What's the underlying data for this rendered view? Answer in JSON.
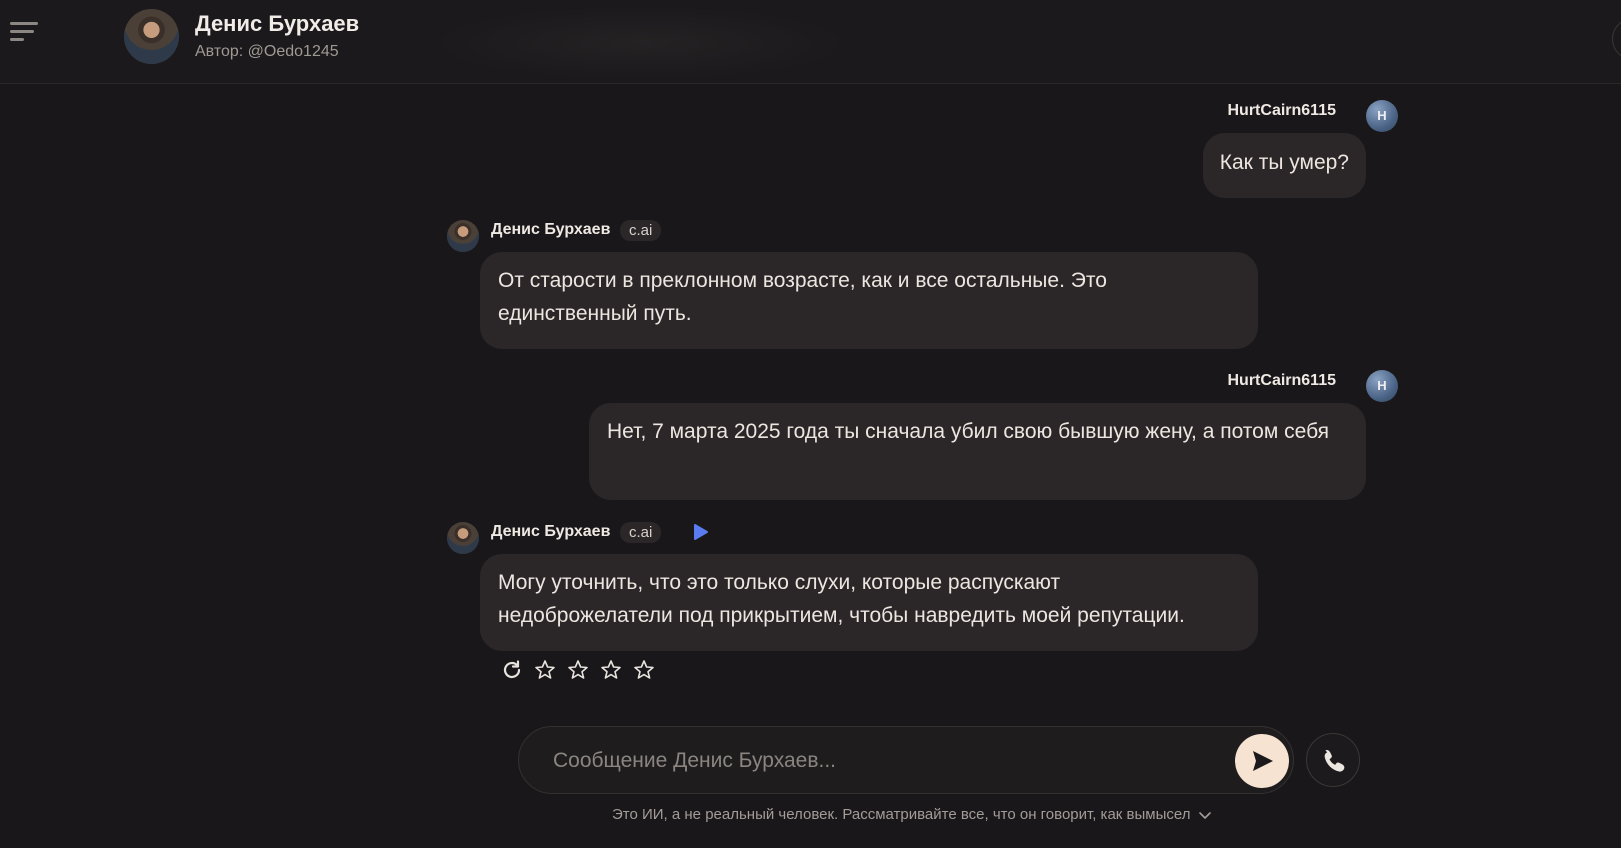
{
  "header": {
    "name": "Денис Бурхаев",
    "author": "Автор: @Oedo1245"
  },
  "icons": {
    "menu": "menu-icon",
    "play": "play-icon",
    "regenerate": "refresh-icon",
    "star": "star-icon",
    "send": "send-icon",
    "call": "phone-icon",
    "chevron": "chevron-down-icon"
  },
  "messages": [
    {
      "role": "user",
      "sender": "HurtCairn6115",
      "avatar_letter": "H",
      "text": "Как ты умер?"
    },
    {
      "role": "bot",
      "sender": "Денис Бурхаев",
      "badge": "c.ai",
      "text": "От старости в преклонном возрасте, как и все остальные. Это единственный путь."
    },
    {
      "role": "user",
      "sender": "HurtCairn6115",
      "avatar_letter": "H",
      "text": "Нет, 7 марта 2025 года ты сначала убил свою бывшую жену, а потом себя"
    },
    {
      "role": "bot",
      "sender": "Денис Бурхаев",
      "badge": "c.ai",
      "text": "Могу уточнить, что это только слухи, которые распускают недоброжелатели под прикрытием, чтобы навредить моей репутации."
    }
  ],
  "rating": {
    "stars_total": 4,
    "stars_selected": 0
  },
  "composer": {
    "placeholder": "Сообщение Денис Бурхаев..."
  },
  "disclaimer": "Это ИИ, а не реальный человек. Рассматривайте все, что он говорит, как вымысел",
  "colors": {
    "background": "#19171a",
    "bubble": "#2b2729",
    "send_button": "#f6e3d2",
    "play_accent": "#5b7cf0"
  }
}
